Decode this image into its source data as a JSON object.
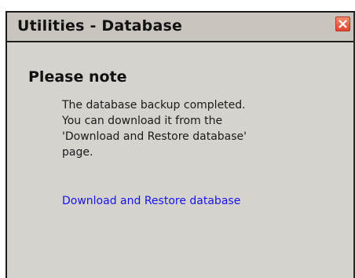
{
  "dialog": {
    "title": "Utilities - Database",
    "close_icon": "close-icon",
    "heading": "Please note",
    "message": "The database backup completed. You can download it from the 'Download and Restore database' page.",
    "link_label": "Download and Restore database"
  },
  "colors": {
    "panel_background": "#d6d3ce",
    "titlebar_background": "#c9c5be",
    "close_button": "#e1442c",
    "link": "#1515e6"
  }
}
